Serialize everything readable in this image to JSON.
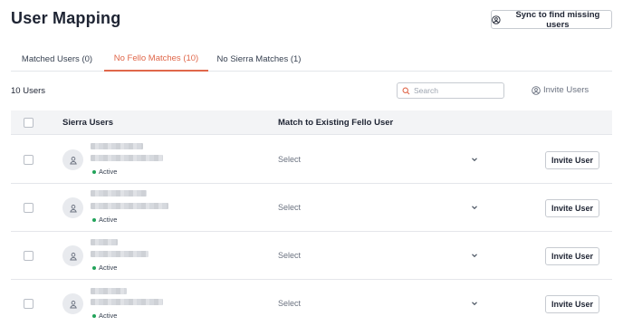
{
  "page": {
    "title": "User Mapping"
  },
  "header": {
    "sync_label": "Sync to find missing users"
  },
  "tabs": [
    {
      "label": "Matched Users (0)",
      "active": false
    },
    {
      "label": "No Fello Matches (10)",
      "active": true
    },
    {
      "label": "No Sierra Matches (1)",
      "active": false
    }
  ],
  "toolbar": {
    "user_count": "10 Users",
    "search_placeholder": "Search",
    "invite_label": "Invite Users"
  },
  "table": {
    "columns": [
      "Sierra Users",
      "Match to Existing Fello User"
    ],
    "rows": [
      {
        "status": "Active",
        "match": "Select",
        "action": "Invite User"
      },
      {
        "status": "Active",
        "match": "Select",
        "action": "Invite User"
      },
      {
        "status": "Active",
        "match": "Select",
        "action": "Invite User"
      },
      {
        "status": "Active",
        "match": "Select",
        "action": "Invite User"
      }
    ]
  },
  "colors": {
    "accent": "#e0674a",
    "active_dot": "#22a35a",
    "header_bg": "#f3f4f6"
  }
}
